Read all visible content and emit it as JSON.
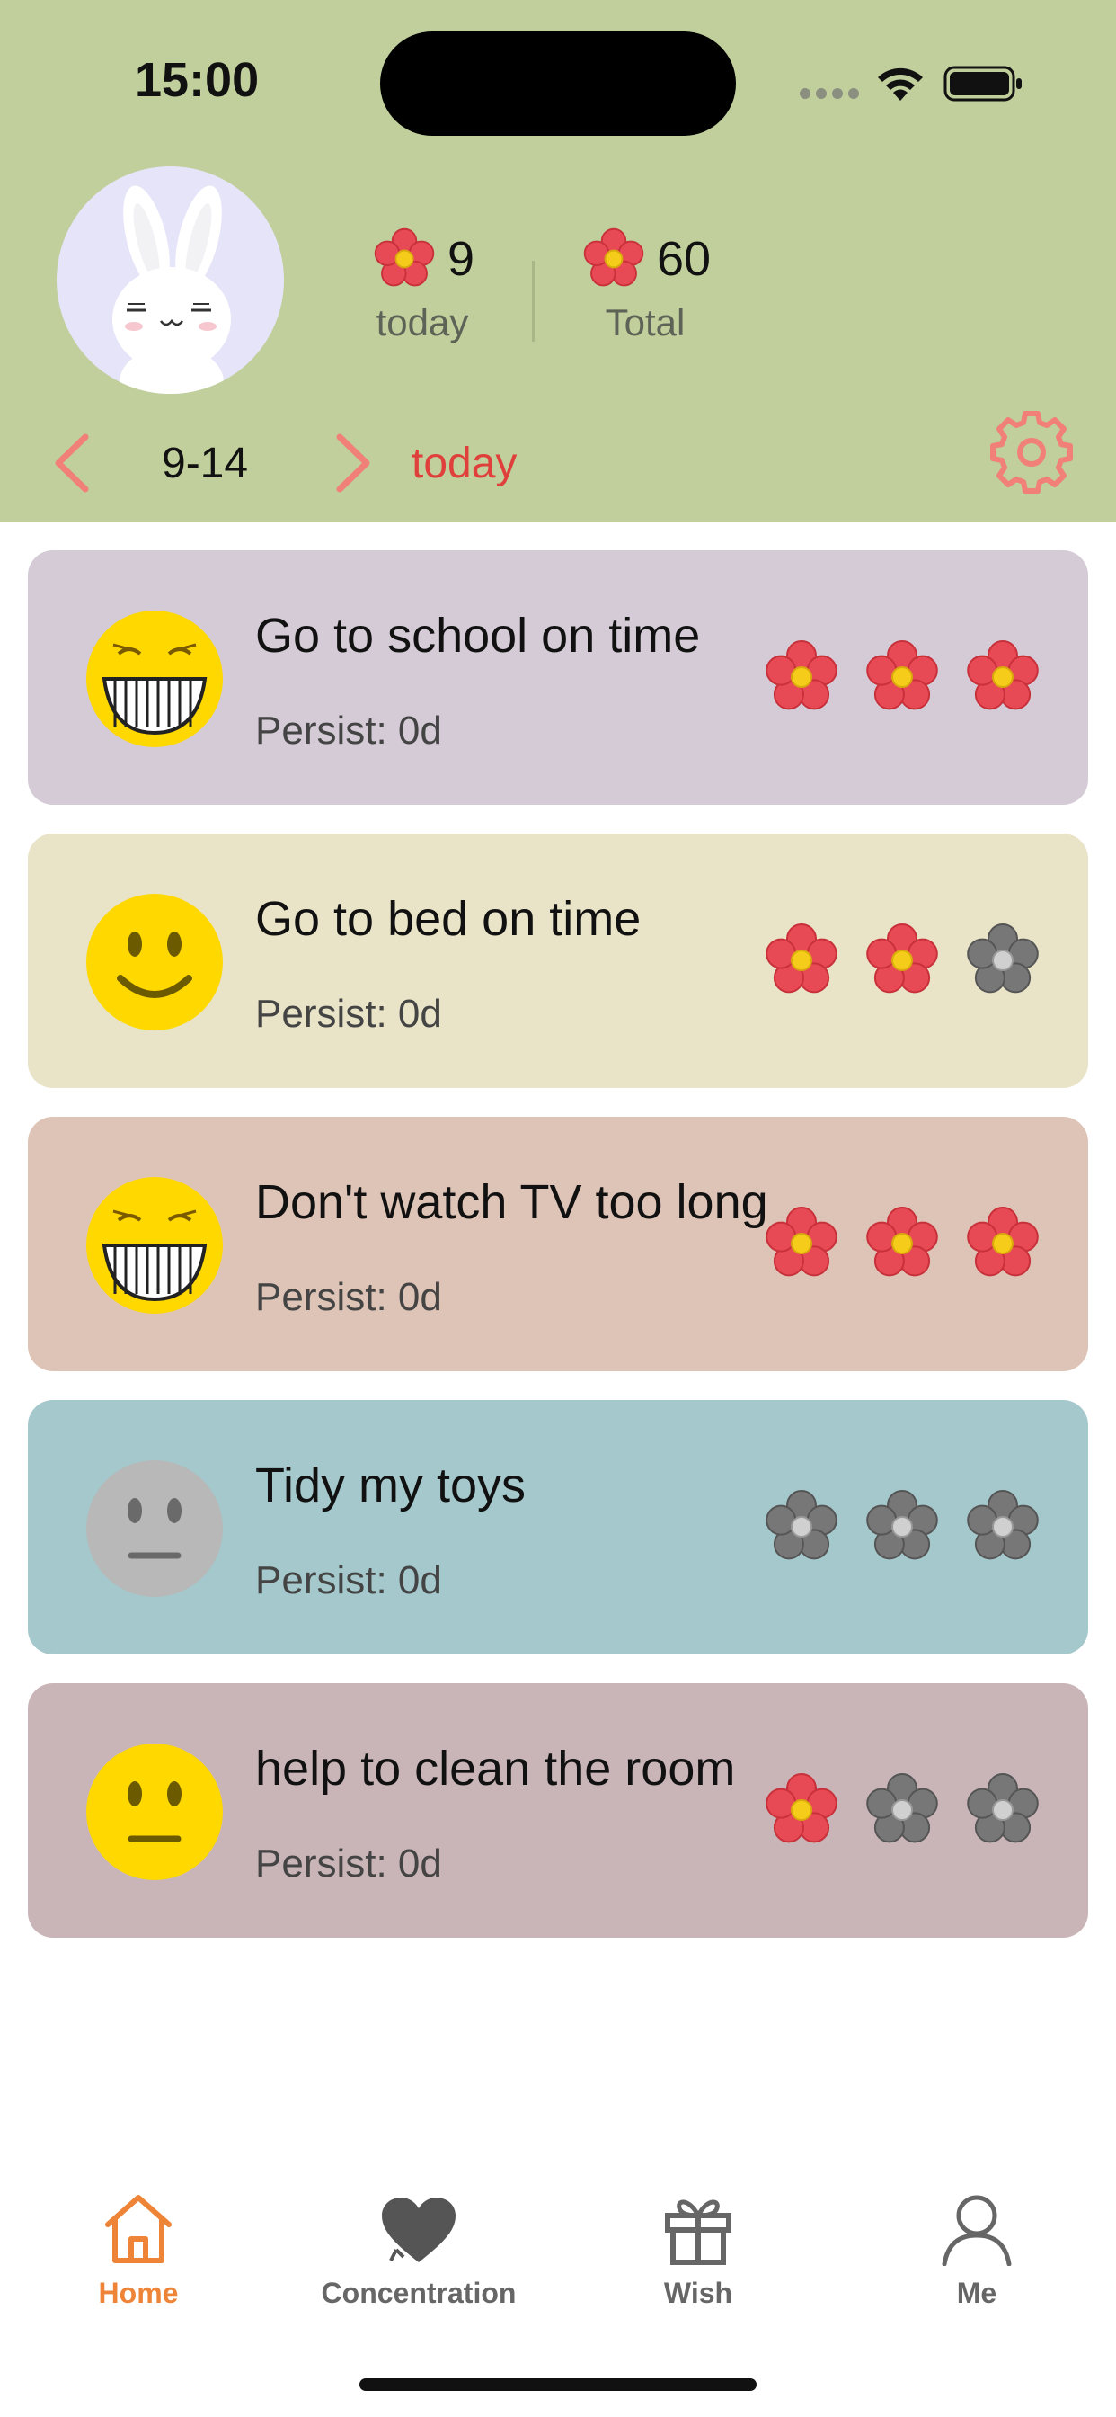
{
  "status_bar": {
    "time": "15:00"
  },
  "header": {
    "stats": {
      "today_value": "9",
      "today_label": "today",
      "total_value": "60",
      "total_label": "Total"
    },
    "date": "9-14",
    "today_button": "today"
  },
  "tasks": [
    {
      "title": "Go to school on time",
      "persist": "Persist: 0d",
      "face": "grin",
      "flowers": [
        1,
        1,
        1
      ],
      "color": "#d4cbd6"
    },
    {
      "title": "Go to bed on time",
      "persist": "Persist: 0d",
      "face": "smile",
      "flowers": [
        1,
        1,
        0
      ],
      "color": "#e9e3c7"
    },
    {
      "title": "Don't watch TV too long",
      "persist": "Persist: 0d",
      "face": "grin",
      "flowers": [
        1,
        1,
        1
      ],
      "color": "#dec4b6"
    },
    {
      "title": "Tidy my toys",
      "persist": "Persist: 0d",
      "face": "neutral-gray",
      "flowers": [
        0,
        0,
        0
      ],
      "color": "#a4c8cc"
    },
    {
      "title": "help to clean the room",
      "persist": "Persist: 0d",
      "face": "neutral",
      "flowers": [
        1,
        0,
        0
      ],
      "color": "#c9b5b8"
    }
  ],
  "tab_bar": {
    "home": "Home",
    "concentration": "Concentration",
    "wish": "Wish",
    "me": "Me",
    "active": "home"
  },
  "colors": {
    "header_bg": "#c0cf9b",
    "accent": "#ee8438",
    "today_red": "#e0403c",
    "flower_red": "#e84a55",
    "flower_gray": "#777777"
  }
}
